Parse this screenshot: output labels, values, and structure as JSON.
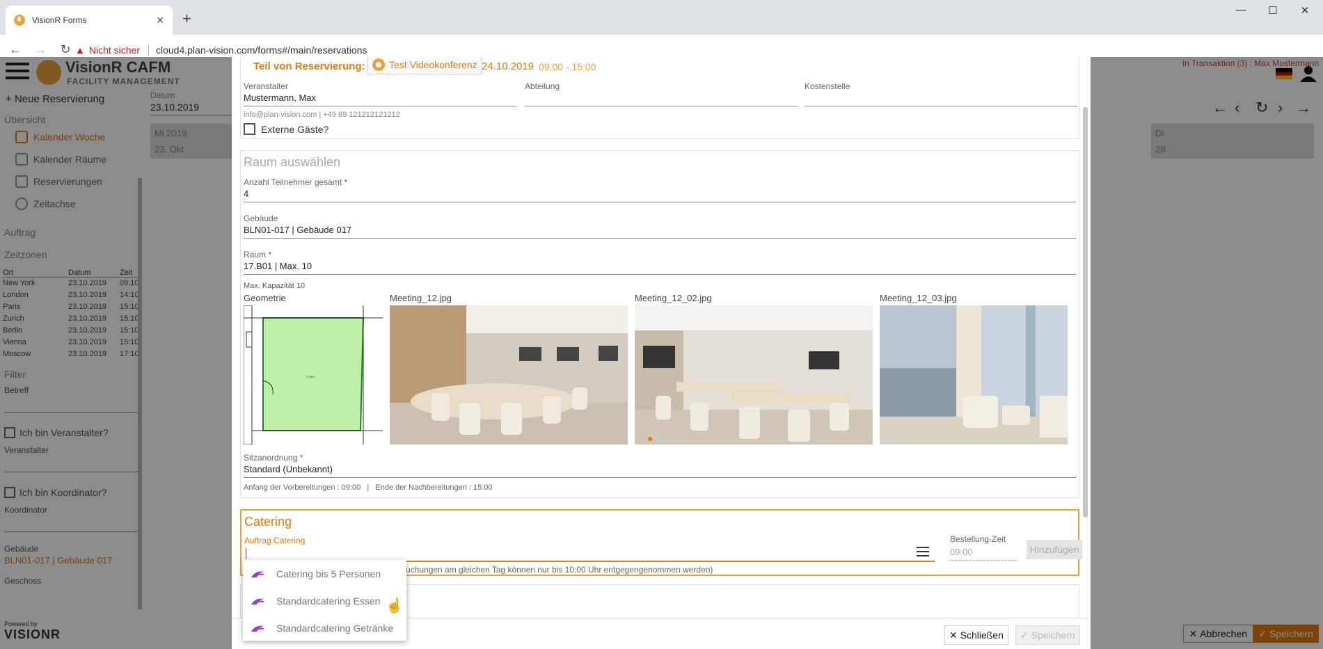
{
  "browser": {
    "tab_title": "VisionR Forms",
    "not_secure": "Nicht sicher",
    "url": "cloud4.plan-vision.com/forms#/main/reservations"
  },
  "app": {
    "title": "VisionR CAFM",
    "subtitle": "FACILITY MANAGEMENT",
    "transaction_info": "In Transaktion (3) : Max Mustermann"
  },
  "sidebar": {
    "new_reservation": "Neue Reservierung",
    "section_overview": "Übersicht",
    "items": [
      {
        "label": "Kalender Woche"
      },
      {
        "label": "Kalender Räume"
      },
      {
        "label": "Reservierungen"
      },
      {
        "label": "Zeitachse"
      }
    ],
    "section_auftrag": "Auftrag",
    "section_zeitzonen": "Zeitzonen",
    "tz_headers": [
      "Ort",
      "Datum",
      "Zeit"
    ],
    "tz_rows": [
      [
        "New York",
        "23.10.2019",
        "09:10"
      ],
      [
        "London",
        "23.10.2019",
        "14:10"
      ],
      [
        "Paris",
        "23.10.2019",
        "15:10"
      ],
      [
        "Zurich",
        "23.10.2019",
        "15:10"
      ],
      [
        "Berlin",
        "23.10.2019",
        "15:10"
      ],
      [
        "Vienna",
        "23.10.2019",
        "15:10"
      ],
      [
        "Moscow",
        "23.10.2019",
        "17:10"
      ]
    ],
    "section_filter": "Filter",
    "betreff_label": "Betreff",
    "check_veranstalter": "Ich bin Veranstalter?",
    "veranstalter_label": "Veranstalter",
    "check_koordinator": "Ich bin Koordinator?",
    "koordinator_label": "Koordinator",
    "gebaeude_label": "Gebäude",
    "gebaeude_value": "BLN01-017 | Gebäude 017",
    "geschoss_label": "Geschoss"
  },
  "main": {
    "date_label": "Datum",
    "date_value": "23.10.2019",
    "cal_col1_day": "Mi 2019",
    "cal_col1_date": "23. Okt",
    "cal_col2_day": "Di",
    "cal_col2_date": "29"
  },
  "footer": {
    "powered_by": "Powered by",
    "brand": "VISIONR",
    "abbrechen": "Abbrechen",
    "speichern": "Speichern"
  },
  "dialog": {
    "teil_label": "Teil von Reservierung:",
    "chip_label": "Test Videokonferenz",
    "res_date": "24.10.2019",
    "res_time": "09:00 - 15:00",
    "veranstalter_label": "Veranstalter",
    "veranstalter_value": "Mustermann, Max",
    "abteilung_label": "Abteilung",
    "kostenstelle_label": "Kostenstelle",
    "contact": "info@plan-vision.com | +49 89 121212121212",
    "externe_gaeste": "Externe Gäste?",
    "raum_title": "Raum auswählen",
    "teilnehmer_label": "Anzahl Teilnehmer gesamt *",
    "teilnehmer_value": "4",
    "gebaeude_label": "Gebäude",
    "gebaeude_value": "BLN01-017 | Gebäude 017",
    "raum_label": "Raum *",
    "raum_value": "17.B01 | Max. 10",
    "kapazitaet": "Max. Kapazität 10",
    "images": [
      {
        "label": "Geometrie"
      },
      {
        "label": "Meeting_12.jpg"
      },
      {
        "label": "Meeting_12_02.jpg"
      },
      {
        "label": "Meeting_12_03.jpg"
      }
    ],
    "sitz_label": "Sitzanordnung *",
    "sitz_value": "Standard (Unbekannt)",
    "vorbereitung": "Anfang der Vorbereitungen : 09:00   |   Ende der Nachbereitungen : 15:00",
    "catering_title": "Catering",
    "auftrag_label": "Auftrag Catering",
    "catering_hint": "Buchungen am gleichen Tag können nur bis 10:00 Uhr entgegengenommen werden)",
    "bestellung_label": "Bestellung-Zeit",
    "bestellung_value": "09:00",
    "hinzufuegen": "Hinzufügen",
    "dropdown": [
      {
        "label": "Catering bis 5 Personen"
      },
      {
        "label": "Standardcatering Essen"
      },
      {
        "label": "Standardcatering Getränke"
      }
    ],
    "schliessen": "Schließen",
    "speichern": "Speichern"
  }
}
